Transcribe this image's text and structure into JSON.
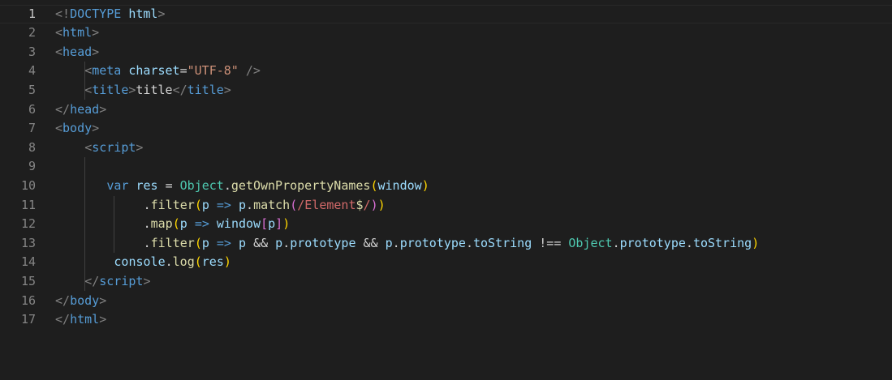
{
  "editor": {
    "active_line": 1,
    "lines": [
      {
        "number": "1",
        "indent": 0,
        "tokens": [
          [
            "t-punct",
            "<!"
          ],
          [
            "t-tag",
            "DOCTYPE"
          ],
          [
            "t-text",
            " "
          ],
          [
            "t-attr",
            "html"
          ],
          [
            "t-punct",
            ">"
          ]
        ]
      },
      {
        "number": "2",
        "indent": 0,
        "tokens": [
          [
            "t-punct",
            "<"
          ],
          [
            "t-tag",
            "html"
          ],
          [
            "t-punct",
            ">"
          ]
        ]
      },
      {
        "number": "3",
        "indent": 0,
        "tokens": [
          [
            "t-punct",
            "<"
          ],
          [
            "t-tag",
            "head"
          ],
          [
            "t-punct",
            ">"
          ]
        ]
      },
      {
        "number": "4",
        "indent": 4,
        "tokens": [
          [
            "t-punct",
            "<"
          ],
          [
            "t-tag",
            "meta"
          ],
          [
            "t-text",
            " "
          ],
          [
            "t-attr",
            "charset"
          ],
          [
            "t-text",
            "="
          ],
          [
            "t-str",
            "\"UTF-8\""
          ],
          [
            "t-text",
            " "
          ],
          [
            "t-punct",
            "/>"
          ]
        ]
      },
      {
        "number": "5",
        "indent": 4,
        "tokens": [
          [
            "t-punct",
            "<"
          ],
          [
            "t-tag",
            "title"
          ],
          [
            "t-punct",
            ">"
          ],
          [
            "t-text",
            "title"
          ],
          [
            "t-punct",
            "</"
          ],
          [
            "t-tag",
            "title"
          ],
          [
            "t-punct",
            ">"
          ]
        ]
      },
      {
        "number": "6",
        "indent": 0,
        "tokens": [
          [
            "t-punct",
            "</"
          ],
          [
            "t-tag",
            "head"
          ],
          [
            "t-punct",
            ">"
          ]
        ]
      },
      {
        "number": "7",
        "indent": 0,
        "tokens": [
          [
            "t-punct",
            "<"
          ],
          [
            "t-tag",
            "body"
          ],
          [
            "t-punct",
            ">"
          ]
        ]
      },
      {
        "number": "8",
        "indent": 4,
        "tokens": [
          [
            "t-punct",
            "<"
          ],
          [
            "t-tag",
            "script"
          ],
          [
            "t-punct",
            ">"
          ]
        ]
      },
      {
        "number": "9",
        "indent": 0,
        "tokens": []
      },
      {
        "number": "10",
        "indent": 7,
        "tokens": [
          [
            "t-kw",
            "var"
          ],
          [
            "t-text",
            " "
          ],
          [
            "t-var",
            "res"
          ],
          [
            "t-text",
            " "
          ],
          [
            "t-op",
            "="
          ],
          [
            "t-text",
            " "
          ],
          [
            "t-cls",
            "Object"
          ],
          [
            "t-text",
            "."
          ],
          [
            "t-fn",
            "getOwnPropertyNames"
          ],
          [
            "t-b1",
            "("
          ],
          [
            "t-var",
            "window"
          ],
          [
            "t-b1",
            ")"
          ]
        ]
      },
      {
        "number": "11",
        "indent": 12,
        "tokens": [
          [
            "t-text",
            "."
          ],
          [
            "t-fn",
            "filter"
          ],
          [
            "t-b1",
            "("
          ],
          [
            "t-var",
            "p"
          ],
          [
            "t-text",
            " "
          ],
          [
            "t-kw",
            "=>"
          ],
          [
            "t-text",
            " "
          ],
          [
            "t-var",
            "p"
          ],
          [
            "t-text",
            "."
          ],
          [
            "t-fn",
            "match"
          ],
          [
            "t-b2",
            "("
          ],
          [
            "t-regex",
            "/Element"
          ],
          [
            "t-regex2",
            "$"
          ],
          [
            "t-regex",
            "/"
          ],
          [
            "t-b2",
            ")"
          ],
          [
            "t-b1",
            ")"
          ]
        ]
      },
      {
        "number": "12",
        "indent": 12,
        "tokens": [
          [
            "t-text",
            "."
          ],
          [
            "t-fn",
            "map"
          ],
          [
            "t-b1",
            "("
          ],
          [
            "t-var",
            "p"
          ],
          [
            "t-text",
            " "
          ],
          [
            "t-kw",
            "=>"
          ],
          [
            "t-text",
            " "
          ],
          [
            "t-var",
            "window"
          ],
          [
            "t-b2",
            "["
          ],
          [
            "t-var",
            "p"
          ],
          [
            "t-b2",
            "]"
          ],
          [
            "t-b1",
            ")"
          ]
        ]
      },
      {
        "number": "13",
        "indent": 12,
        "tokens": [
          [
            "t-text",
            "."
          ],
          [
            "t-fn",
            "filter"
          ],
          [
            "t-b1",
            "("
          ],
          [
            "t-var",
            "p"
          ],
          [
            "t-text",
            " "
          ],
          [
            "t-kw",
            "=>"
          ],
          [
            "t-text",
            " "
          ],
          [
            "t-var",
            "p"
          ],
          [
            "t-text",
            " "
          ],
          [
            "t-op",
            "&&"
          ],
          [
            "t-text",
            " "
          ],
          [
            "t-var",
            "p"
          ],
          [
            "t-text",
            "."
          ],
          [
            "t-var",
            "prototype"
          ],
          [
            "t-text",
            " "
          ],
          [
            "t-op",
            "&&"
          ],
          [
            "t-text",
            " "
          ],
          [
            "t-var",
            "p"
          ],
          [
            "t-text",
            "."
          ],
          [
            "t-var",
            "prototype"
          ],
          [
            "t-text",
            "."
          ],
          [
            "t-var",
            "toString"
          ],
          [
            "t-text",
            " "
          ],
          [
            "t-op",
            "!=="
          ],
          [
            "t-text",
            " "
          ],
          [
            "t-cls",
            "Object"
          ],
          [
            "t-text",
            "."
          ],
          [
            "t-var",
            "prototype"
          ],
          [
            "t-text",
            "."
          ],
          [
            "t-var",
            "toString"
          ],
          [
            "t-b1",
            ")"
          ]
        ]
      },
      {
        "number": "14",
        "indent": 8,
        "tokens": [
          [
            "t-var",
            "console"
          ],
          [
            "t-text",
            "."
          ],
          [
            "t-fn",
            "log"
          ],
          [
            "t-b1",
            "("
          ],
          [
            "t-var",
            "res"
          ],
          [
            "t-b1",
            ")"
          ]
        ]
      },
      {
        "number": "15",
        "indent": 4,
        "tokens": [
          [
            "t-punct",
            "</"
          ],
          [
            "t-tag",
            "script"
          ],
          [
            "t-punct",
            ">"
          ]
        ]
      },
      {
        "number": "16",
        "indent": 0,
        "tokens": [
          [
            "t-punct",
            "</"
          ],
          [
            "t-tag",
            "body"
          ],
          [
            "t-punct",
            ">"
          ]
        ]
      },
      {
        "number": "17",
        "indent": 0,
        "tokens": [
          [
            "t-punct",
            "</"
          ],
          [
            "t-tag",
            "html"
          ],
          [
            "t-punct",
            ">"
          ]
        ]
      }
    ]
  }
}
